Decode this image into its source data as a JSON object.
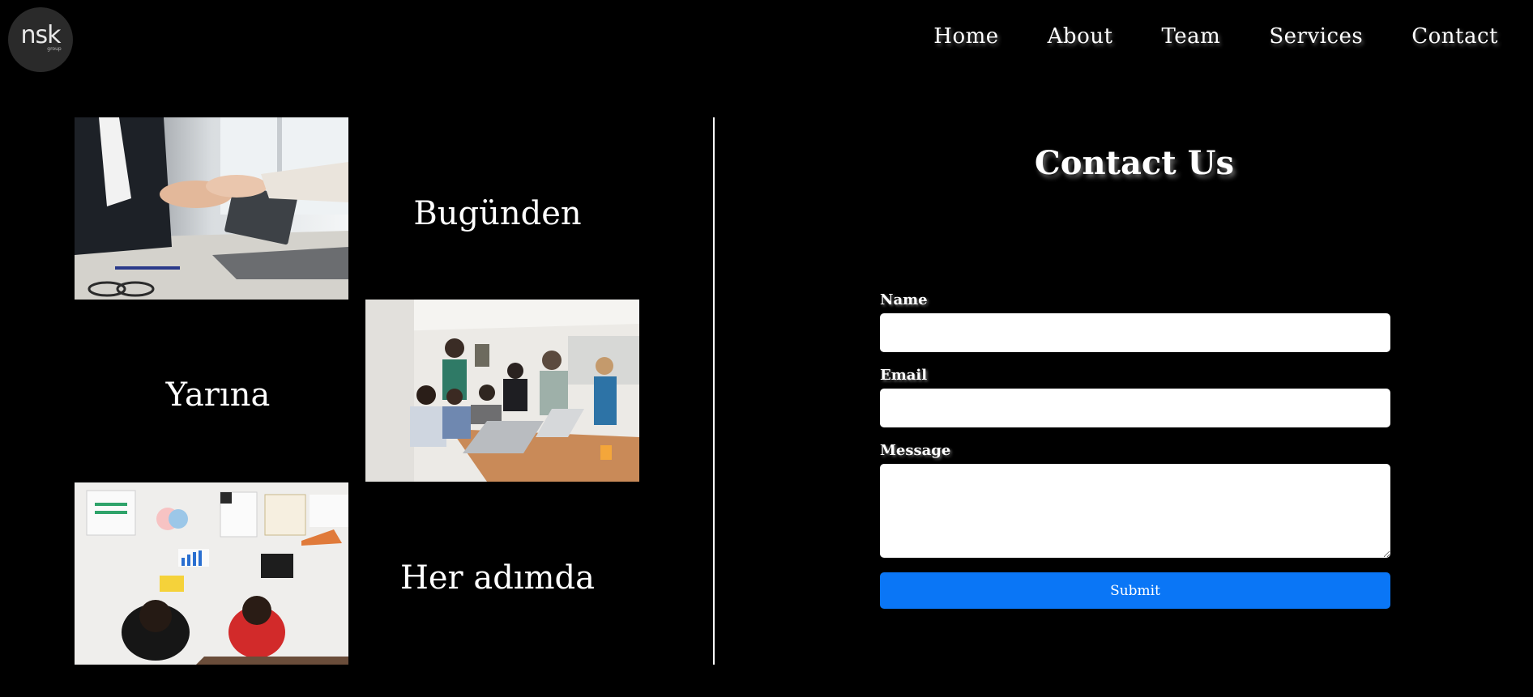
{
  "header": {
    "logo": {
      "text": "nsk",
      "sub": "group"
    },
    "nav": [
      "Home",
      "About",
      "Team",
      "Services",
      "Contact"
    ]
  },
  "gallery": {
    "captions": [
      "Bugünden",
      "Yarına",
      "Her adımda"
    ]
  },
  "contact": {
    "title": "Contact Us",
    "name_label": "Name",
    "email_label": "Email",
    "message_label": "Message",
    "submit_label": "Submit"
  },
  "colors": {
    "background": "#000000",
    "submit": "#0a76f6",
    "field": "#ffffff"
  }
}
